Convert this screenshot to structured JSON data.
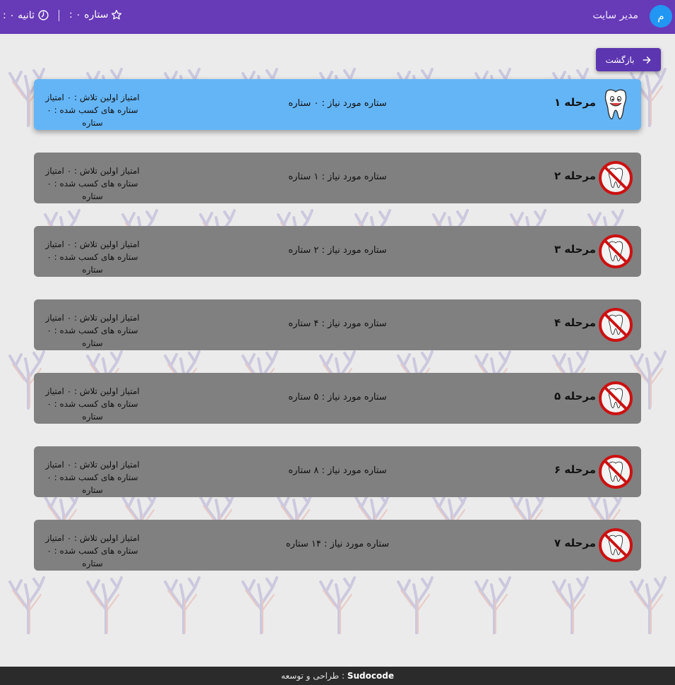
{
  "header": {
    "avatar_letter": "م",
    "username": "مدیر سایت",
    "stars_text": ": ۰ ستاره",
    "time_text": ": ۰ ثانیه",
    "accent_color": "#673ab7"
  },
  "back_button": {
    "label": "بازگشت",
    "icon": "arrow-right-icon"
  },
  "levels": [
    {
      "name": "مرحله ۱",
      "required": "ستاره مورد نیاز : ۰ ستاره",
      "first_score": "امتیاز اولین تلاش : ۰ امتیاز",
      "earned": "ستاره های کسب شده : ۰ ستاره",
      "status": "unlocked",
      "icon": "smiling-tooth-icon"
    },
    {
      "name": "مرحله ۲",
      "required": "ستاره مورد نیاز : ۱ ستاره",
      "first_score": "امتیاز اولین تلاش : ۰ امتیاز",
      "earned": "ستاره های کسب شده : ۰ ستاره",
      "status": "locked",
      "icon": "locked-tooth-icon"
    },
    {
      "name": "مرحله ۳",
      "required": "ستاره مورد نیاز : ۲ ستاره",
      "first_score": "امتیاز اولین تلاش : ۰ امتیاز",
      "earned": "ستاره های کسب شده : ۰ ستاره",
      "status": "locked",
      "icon": "locked-tooth-icon"
    },
    {
      "name": "مرحله ۴",
      "required": "ستاره مورد نیاز : ۴ ستاره",
      "first_score": "امتیاز اولین تلاش : ۰ امتیاز",
      "earned": "ستاره های کسب شده : ۰ ستاره",
      "status": "locked",
      "icon": "locked-tooth-icon"
    },
    {
      "name": "مرحله ۵",
      "required": "ستاره مورد نیاز : ۵ ستاره",
      "first_score": "امتیاز اولین تلاش : ۰ امتیاز",
      "earned": "ستاره های کسب شده : ۰ ستاره",
      "status": "locked",
      "icon": "locked-tooth-icon"
    },
    {
      "name": "مرحله ۶",
      "required": "ستاره مورد نیاز : ۸ ستاره",
      "first_score": "امتیاز اولین تلاش : ۰ امتیاز",
      "earned": "ستاره های کسب شده : ۰ ستاره",
      "status": "locked",
      "icon": "locked-tooth-icon"
    },
    {
      "name": "مرحله ۷",
      "required": "ستاره مورد نیاز : ۱۴ ستاره",
      "first_score": "امتیاز اولین تلاش : ۰ امتیاز",
      "earned": "ستاره های کسب شده : ۰ ستاره",
      "status": "locked",
      "icon": "locked-tooth-icon"
    }
  ],
  "footer": {
    "label": "طراحی و توسعه :",
    "brand": "Sudocode"
  }
}
